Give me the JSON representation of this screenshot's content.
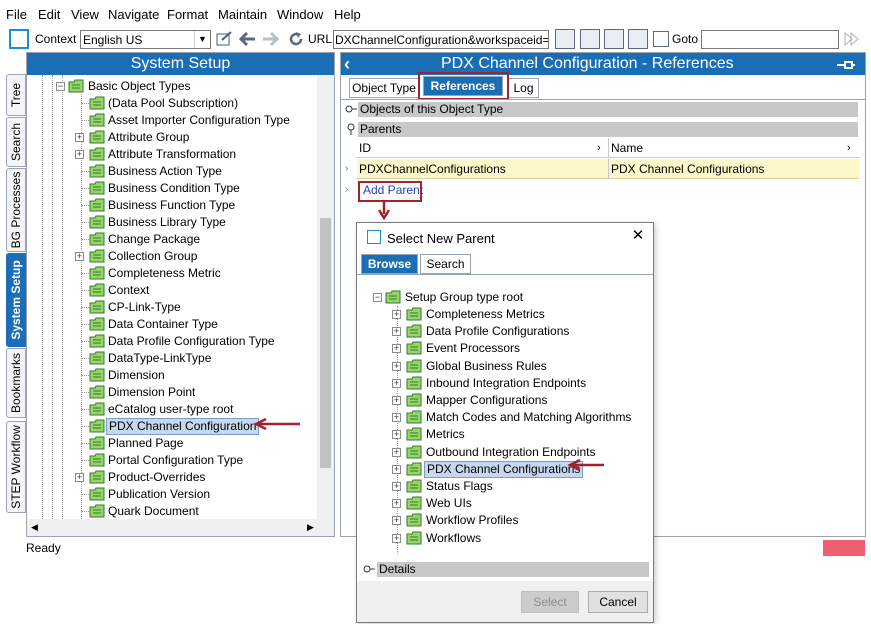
{
  "menu": [
    "File",
    "Edit",
    "View",
    "Navigate",
    "Format",
    "Maintain",
    "Window",
    "Help"
  ],
  "toolbar": {
    "context_label": "Context",
    "context_value": "English US",
    "url_label": "URL",
    "url_value": "DXChannelConfiguration&workspaceid=Main",
    "goto_label": "Goto",
    "goto_value": ""
  },
  "left_tabs": [
    "Tree",
    "Search",
    "BG Processes",
    "System Setup",
    "Bookmarks",
    "STEP Workflow"
  ],
  "left_panel": {
    "title": "System Setup",
    "root": "Basic Object Types",
    "items": [
      {
        "label": "(Data Pool Subscription)",
        "expandable": false
      },
      {
        "label": "Asset Importer Configuration Type",
        "expandable": false
      },
      {
        "label": "Attribute Group",
        "expandable": true
      },
      {
        "label": "Attribute Transformation",
        "expandable": true
      },
      {
        "label": "Business Action Type",
        "expandable": false
      },
      {
        "label": "Business Condition Type",
        "expandable": false
      },
      {
        "label": "Business Function Type",
        "expandable": false
      },
      {
        "label": "Business Library Type",
        "expandable": false
      },
      {
        "label": "Change Package",
        "expandable": false
      },
      {
        "label": "Collection Group",
        "expandable": true
      },
      {
        "label": "Completeness Metric",
        "expandable": false
      },
      {
        "label": "Context",
        "expandable": false
      },
      {
        "label": "CP-Link-Type",
        "expandable": false
      },
      {
        "label": "Data Container Type",
        "expandable": false
      },
      {
        "label": "Data Profile Configuration Type",
        "expandable": false
      },
      {
        "label": "DataType-LinkType",
        "expandable": false
      },
      {
        "label": "Dimension",
        "expandable": false
      },
      {
        "label": "Dimension Point",
        "expandable": false
      },
      {
        "label": "eCatalog user-type root",
        "expandable": false
      },
      {
        "label": "PDX Channel Configuration",
        "expandable": false,
        "selected": true
      },
      {
        "label": "Planned Page",
        "expandable": false
      },
      {
        "label": "Portal Configuration Type",
        "expandable": false
      },
      {
        "label": "Product-Overrides",
        "expandable": true
      },
      {
        "label": "Publication Version",
        "expandable": false
      },
      {
        "label": "Quark Document",
        "expandable": false
      }
    ]
  },
  "right_panel": {
    "title": "PDX Channel Configuration - References",
    "tabs": [
      "Object Type",
      "References",
      "Log"
    ],
    "active_tab": "References",
    "section_objects": "Objects of this Object Type",
    "section_parents": "Parents",
    "grid_headers": [
      "ID",
      "Name"
    ],
    "grid_rows": [
      {
        "id": "PDXChannelConfigurations",
        "name": "PDX Channel Configurations"
      }
    ],
    "add_parent": "Add Parent"
  },
  "dialog": {
    "title": "Select New Parent",
    "tabs": [
      "Browse",
      "Search"
    ],
    "active_tab": "Browse",
    "root": "Setup Group type root",
    "items": [
      {
        "label": "Completeness Metrics"
      },
      {
        "label": "Data Profile Configurations"
      },
      {
        "label": "Event Processors"
      },
      {
        "label": "Global Business Rules"
      },
      {
        "label": "Inbound Integration Endpoints"
      },
      {
        "label": "Mapper Configurations"
      },
      {
        "label": "Match Codes and Matching Algorithms"
      },
      {
        "label": "Metrics"
      },
      {
        "label": "Outbound Integration Endpoints"
      },
      {
        "label": "PDX Channel Configurations",
        "selected": true
      },
      {
        "label": "Status Flags"
      },
      {
        "label": "Web UIs"
      },
      {
        "label": "Workflow Profiles"
      },
      {
        "label": "Workflows"
      }
    ],
    "details": "Details",
    "select_button": "Select",
    "cancel_button": "Cancel"
  },
  "status": "Ready",
  "colors": {
    "header_blue": "#1a6eb5",
    "highlight_yellow": "#fbf7c8",
    "annotation_red": "#a3232c",
    "selection_blue": "#c5d8f0"
  }
}
